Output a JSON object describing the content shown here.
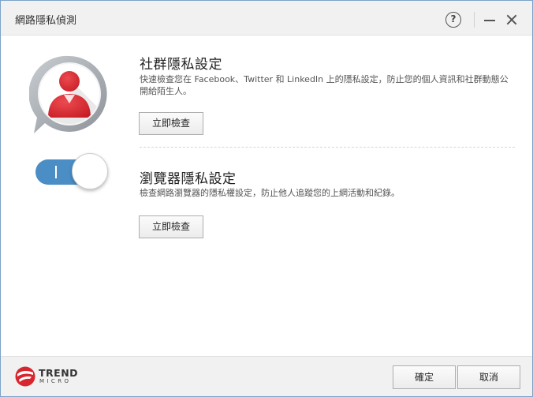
{
  "window": {
    "title": "網路隱私偵測"
  },
  "titlebar": {
    "help_symbol": "?"
  },
  "social": {
    "title": "社群隱私設定",
    "description": "快速檢查您在 Facebook、Twitter 和 LinkedIn 上的隱私設定，防止您的個人資訊和社群動態公開給陌生人。",
    "check_button": "立即檢查"
  },
  "browser": {
    "title": "瀏覽器隱私設定",
    "description": "檢查網路瀏覽器的隱私權設定，防止他人追蹤您的上網活動和紀錄。",
    "check_button": "立即檢查"
  },
  "footer": {
    "logo_word": "TREND",
    "logo_sub": "MICRO",
    "ok_button": "確定",
    "cancel_button": "取消"
  },
  "colors": {
    "accent_red": "#d7262e",
    "toggle_blue": "#4a8ec5",
    "frame_gray": "#9aa0a6"
  },
  "icons": [
    "help-icon",
    "minimize-icon",
    "close-icon",
    "social-privacy-icon",
    "browser-toggle-icon",
    "trend-micro-logo"
  ]
}
